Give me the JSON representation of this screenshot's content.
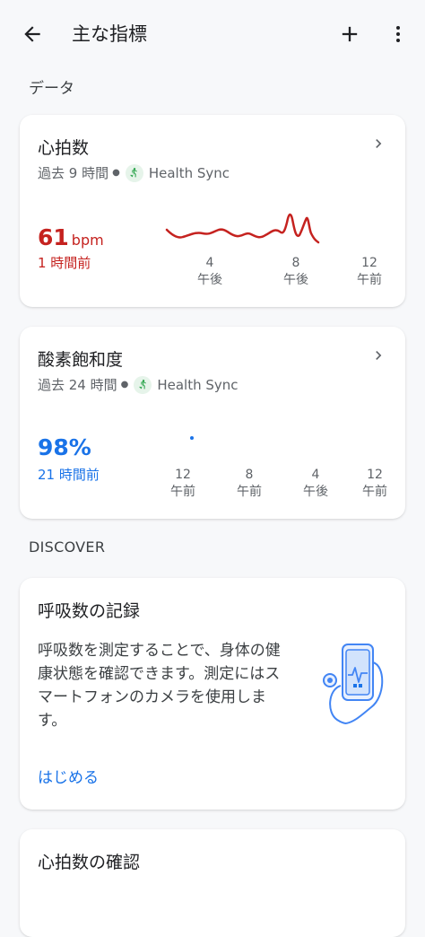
{
  "header": {
    "title": "主な指標"
  },
  "sections": {
    "data_label": "データ",
    "discover_label": "DISCOVER"
  },
  "heart_rate": {
    "title": "心拍数",
    "period": "過去 9 時間",
    "source": "Health Sync",
    "value": "61",
    "unit": "bpm",
    "ago": "1 時間前",
    "color": "#c5221f",
    "ticks": [
      {
        "num": "4",
        "ampm": "午後"
      },
      {
        "num": "8",
        "ampm": "午後"
      },
      {
        "num": "12",
        "ampm": "午前"
      }
    ]
  },
  "spo2": {
    "title": "酸素飽和度",
    "period": "過去 24 時間",
    "source": "Health Sync",
    "value": "98%",
    "ago": "21 時間前",
    "color": "#1a73e8",
    "ticks": [
      {
        "num": "12",
        "ampm": "午前"
      },
      {
        "num": "8",
        "ampm": "午前"
      },
      {
        "num": "4",
        "ampm": "午後"
      },
      {
        "num": "12",
        "ampm": "午前"
      }
    ]
  },
  "discover": {
    "card1": {
      "title": "呼吸数の記録",
      "lines": [
        "呼吸数を測定することで、身体の健",
        "康状態を確認できます。測定にはス",
        "マートフォンのカメラを使用しま",
        "す。"
      ],
      "link": "はじめる"
    },
    "card2": {
      "title": "心拍数の確認"
    }
  },
  "icons": {
    "back": "arrow-back-icon",
    "add": "plus-icon",
    "more": "more-vert-icon",
    "chevron": "chevron-right-icon",
    "source": "health-sync-icon",
    "illustration": "phone-stethoscope-illustration"
  }
}
